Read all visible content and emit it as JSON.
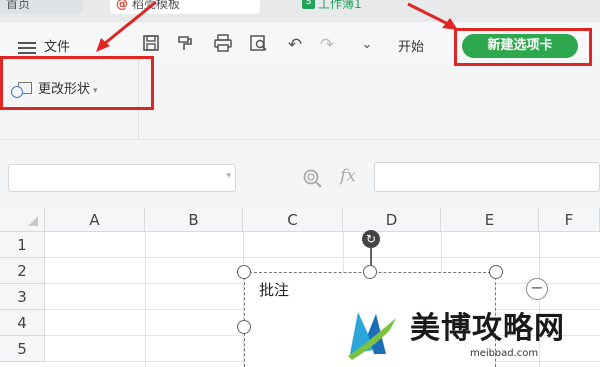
{
  "tabs": {
    "home": "首页",
    "template": "稻壳模板",
    "workbook": "工作簿1",
    "workbook_icon": "S"
  },
  "toolbar": {
    "menu_label": "文件",
    "start_label": "开始",
    "new_tab_label": "新建选项卡",
    "icons": [
      "save-icon",
      "format-painter-icon",
      "print-icon",
      "print-preview-icon",
      "undo-icon",
      "redo-icon",
      "more-dropdown-icon"
    ]
  },
  "ribbon": {
    "change_shape_label": "更改形状"
  },
  "formula_bar": {
    "name_box_value": "",
    "fx_label": "fx",
    "formula_value": ""
  },
  "sheet": {
    "columns": [
      "A",
      "B",
      "C",
      "D",
      "E",
      "F"
    ],
    "rows": [
      "1",
      "2",
      "3",
      "4",
      "5"
    ]
  },
  "comment": {
    "text": "批注"
  },
  "watermark": {
    "brand": "美博攻略网",
    "url": "meiboad.com"
  },
  "colors": {
    "accent_green": "#2ea84e",
    "annotation_red": "#e02525"
  }
}
